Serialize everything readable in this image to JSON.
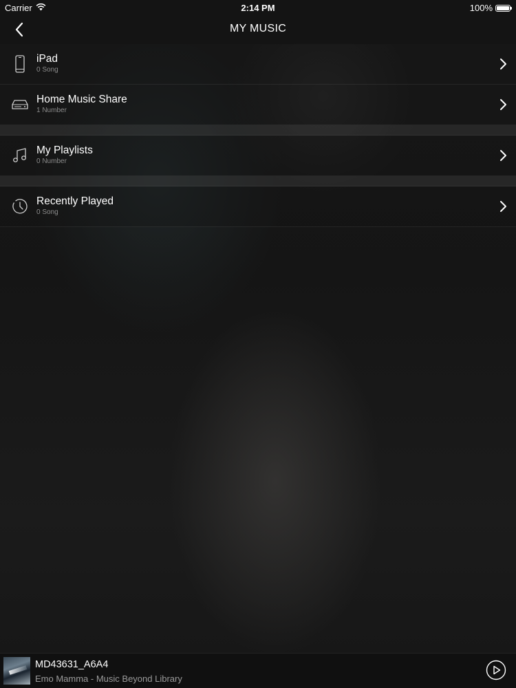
{
  "status_bar": {
    "carrier": "Carrier",
    "time": "2:14 PM",
    "battery": "100%",
    "battery_level": 1.0
  },
  "nav": {
    "title": "MY MUSIC",
    "back_icon": "chevron-left-icon"
  },
  "sections": [
    {
      "items": [
        {
          "label": "iPad",
          "sub": "0 Song",
          "icon": "tablet-icon"
        },
        {
          "label": "Home Music Share",
          "sub": "1 Number",
          "icon": "media-server-icon"
        }
      ]
    },
    {
      "items": [
        {
          "label": "My Playlists",
          "sub": "0 Number",
          "icon": "music-note-icon"
        }
      ]
    },
    {
      "items": [
        {
          "label": "Recently Played",
          "sub": "0 Song",
          "icon": "history-clock-icon"
        }
      ]
    }
  ],
  "mini_player": {
    "track": "MD43631_A6A4",
    "artist": "Emo Mamma - Music Beyond Library",
    "play_icon": "play-circle-icon"
  }
}
